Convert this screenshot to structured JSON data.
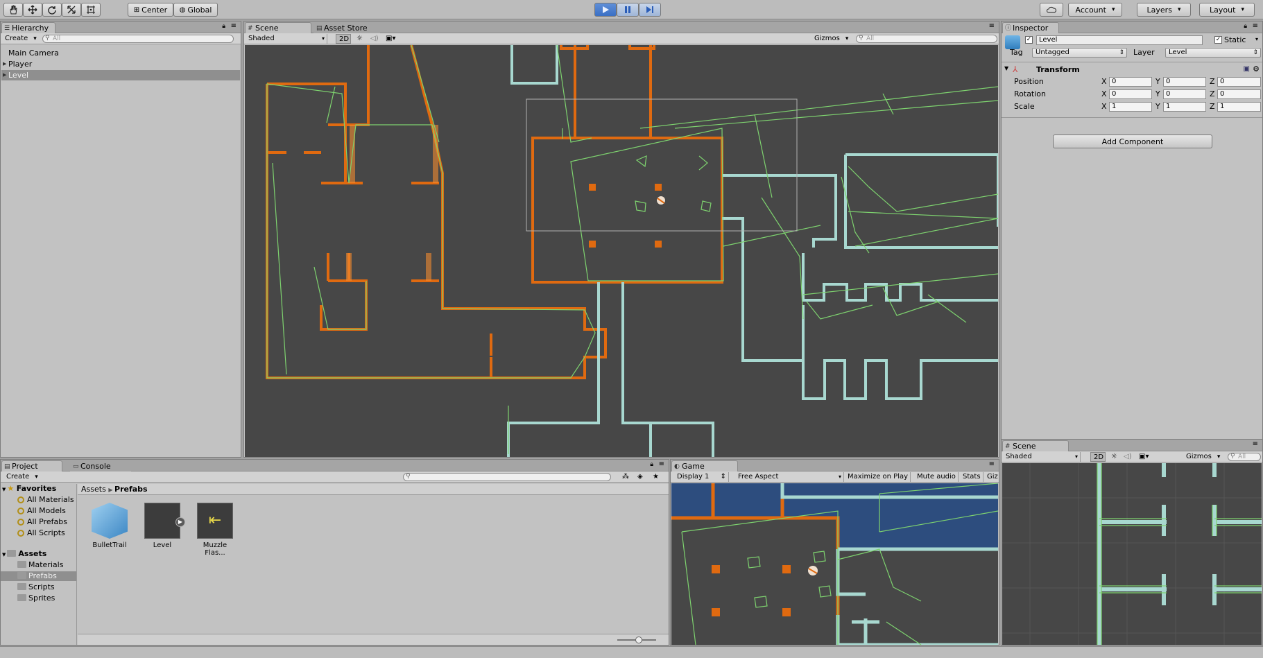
{
  "toolbar": {
    "tools": [
      "hand-tool",
      "move-tool",
      "rotate-tool",
      "scale-tool",
      "rect-tool"
    ],
    "pivot": "Center",
    "space": "Global",
    "account": "Account",
    "layers": "Layers",
    "layout": "Layout"
  },
  "hierarchy": {
    "tab": "Hierarchy",
    "create": "Create",
    "search_placeholder": "All",
    "items": [
      {
        "label": "Main Camera"
      },
      {
        "label": "Player"
      },
      {
        "label": "Level"
      }
    ]
  },
  "scene": {
    "tab": "Scene",
    "tab2": "Asset Store",
    "shading": "Shaded",
    "mode2d": "2D",
    "gizmos": "Gizmos",
    "search_placeholder": "All"
  },
  "inspector": {
    "tab": "Inspector",
    "object_name": "Level",
    "static_label": "Static",
    "tag_label": "Tag",
    "tag_value": "Untagged",
    "layer_label": "Layer",
    "layer_value": "Level",
    "component": "Transform",
    "rows": [
      {
        "label": "Position",
        "x": "0",
        "y": "0",
        "z": "0"
      },
      {
        "label": "Rotation",
        "x": "0",
        "y": "0",
        "z": "0"
      },
      {
        "label": "Scale",
        "x": "1",
        "y": "1",
        "z": "1"
      }
    ],
    "axis": {
      "x": "X",
      "y": "Y",
      "z": "Z"
    },
    "add_component": "Add Component"
  },
  "scene2": {
    "tab": "Scene",
    "shading": "Shaded",
    "mode2d": "2D",
    "gizmos": "Gizmos",
    "search_placeholder": "All"
  },
  "project": {
    "tab": "Project",
    "tab2": "Console",
    "create": "Create",
    "favorites_label": "Favorites",
    "favorites": [
      "All Materials",
      "All Models",
      "All Prefabs",
      "All Scripts"
    ],
    "assets_label": "Assets",
    "folders": [
      "Materials",
      "Prefabs",
      "Scripts",
      "Sprites"
    ],
    "breadcrumb": [
      "Assets",
      "Prefabs"
    ],
    "prefabs": [
      "BulletTrail",
      "Level",
      "Muzzle Flas..."
    ]
  },
  "game": {
    "tab": "Game",
    "display": "Display 1",
    "aspect": "Free Aspect",
    "maximize": "Maximize on Play",
    "mute": "Mute audio",
    "stats": "Stats",
    "gizmos_cut": "Giz"
  },
  "colors": {
    "wall_orange": "#e06a10",
    "wall_teal": "#a8d8d0",
    "collider": "#7ed36f",
    "scene_bg": "#474747",
    "game_bg": "#2d4d7e",
    "play_active": "#3a6fc4"
  }
}
